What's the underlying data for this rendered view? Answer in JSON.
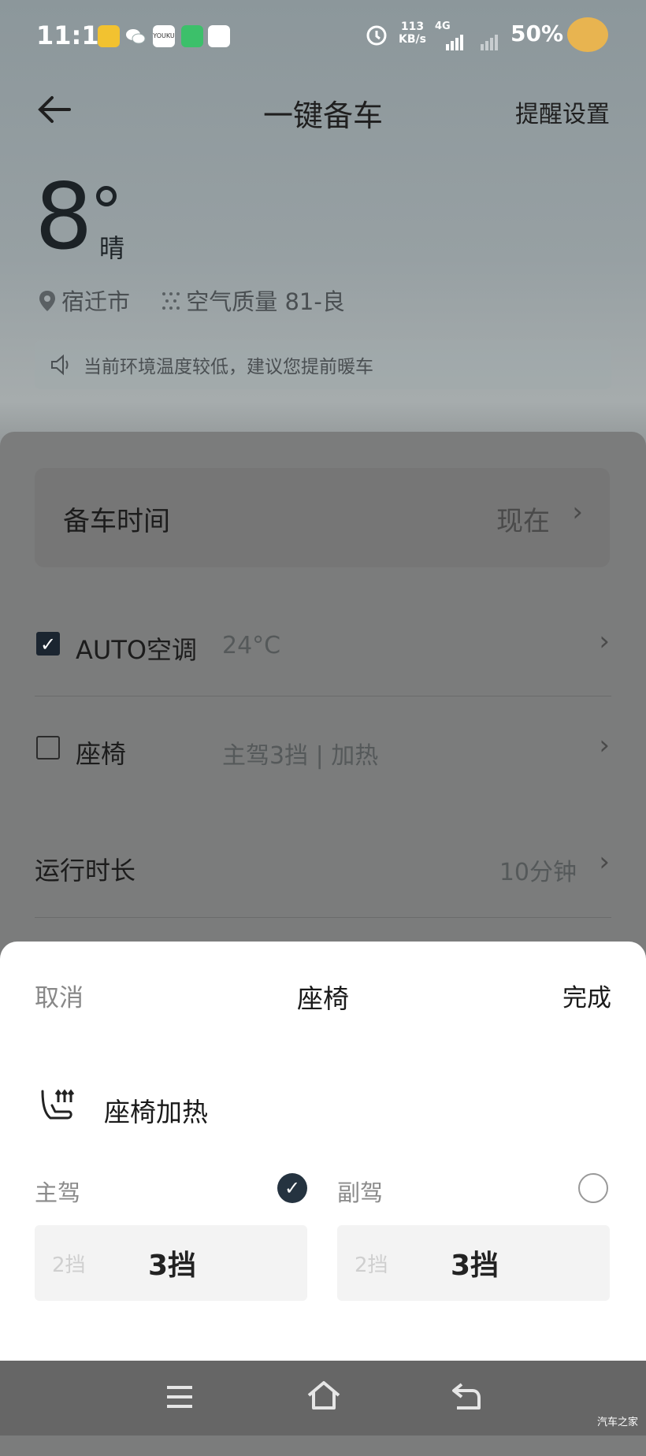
{
  "status_bar": {
    "time": "11:11",
    "net_speed": "113",
    "net_unit": "KB/s",
    "net_type": "4G",
    "battery": "50%"
  },
  "header": {
    "title": "一键备车",
    "remind": "提醒设置"
  },
  "weather": {
    "temp": "8",
    "condition": "晴",
    "location": "宿迁市",
    "air": "空气质量 81-良"
  },
  "notice": "当前环境温度较低，建议您提前暖车",
  "settings": {
    "time_label": "备车时间",
    "time_value": "现在",
    "ac_label": "AUTO空调",
    "ac_value": "24°C",
    "seat_label": "座椅",
    "seat_value": "主驾3挡 | 加热",
    "run_label": "运行时长",
    "run_value": "10分钟"
  },
  "sheet": {
    "cancel": "取消",
    "title": "座椅",
    "done": "完成",
    "section": "座椅加热",
    "driver": "主驾",
    "passenger": "副驾",
    "driver_prev": "2挡",
    "driver_cur": "3挡",
    "passenger_prev": "2挡",
    "passenger_cur": "3挡"
  },
  "watermark": "汽车之家"
}
